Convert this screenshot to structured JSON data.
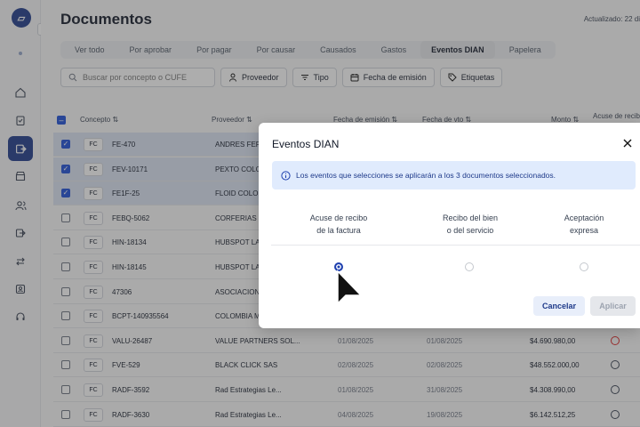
{
  "header": {
    "title": "Documentos",
    "updated": "Actualizado: 22 di"
  },
  "tabs": [
    "Ver todo",
    "Por aprobar",
    "Por pagar",
    "Por causar",
    "Causados",
    "Gastos",
    "Eventos DIAN",
    "Papelera"
  ],
  "active_tab": "Eventos DIAN",
  "search": {
    "placeholder": "Buscar por concepto o CUFE"
  },
  "filters": {
    "proveedor": "Proveedor",
    "tipo": "Tipo",
    "fecha_emision": "Fecha de emisión",
    "etiquetas": "Etiquetas"
  },
  "table": {
    "headers": {
      "concepto": "Concepto",
      "proveedor": "Proveedor",
      "fecha_emision": "Fecha de emisión",
      "fecha_vto": "Fecha de vto",
      "monto": "Monto",
      "acuse": "Acuse de recib"
    },
    "rows": [
      {
        "type": "FC",
        "concept": "FE-470",
        "provider": "ANDRES FERN",
        "emision": "",
        "vto": "",
        "monto": "",
        "selected": true
      },
      {
        "type": "FC",
        "concept": "FEV-10171",
        "provider": "PEXTO COLO",
        "emision": "",
        "vto": "",
        "monto": "",
        "selected": true
      },
      {
        "type": "FC",
        "concept": "FE1F-25",
        "provider": "FLOID COLOM",
        "emision": "",
        "vto": "",
        "monto": "",
        "selected": true
      },
      {
        "type": "FC",
        "concept": "FEBQ-5062",
        "provider": "CORFERIAS IN",
        "emision": "",
        "vto": "",
        "monto": "",
        "selected": false
      },
      {
        "type": "FC",
        "concept": "HIN-18134",
        "provider": "HUBSPOT LA",
        "emision": "",
        "vto": "",
        "monto": "",
        "selected": false
      },
      {
        "type": "FC",
        "concept": "HIN-18145",
        "provider": "HUBSPOT LA",
        "emision": "",
        "vto": "",
        "monto": "",
        "selected": false
      },
      {
        "type": "FC",
        "concept": "47306",
        "provider": "ASOCIACION",
        "emision": "",
        "vto": "",
        "monto": "",
        "selected": false
      },
      {
        "type": "FC",
        "concept": "BCPT-140935564",
        "provider": "COLOMBIA M",
        "emision": "",
        "vto": "",
        "monto": "",
        "selected": false
      },
      {
        "type": "FC",
        "concept": "VALU-26487",
        "provider": "VALUE PARTNERS SOL...",
        "emision": "01/08/2025",
        "vto": "01/08/2025",
        "monto": "$4.690.980,00",
        "selected": false
      },
      {
        "type": "FC",
        "concept": "FVE-529",
        "provider": "BLACK CLICK SAS",
        "emision": "02/08/2025",
        "vto": "02/08/2025",
        "monto": "$48.552.000,00",
        "selected": false
      },
      {
        "type": "FC",
        "concept": "RADF-3592",
        "provider": "Rad Estrategias Le...",
        "emision": "01/08/2025",
        "vto": "31/08/2025",
        "monto": "$4.308.990,00",
        "selected": false
      },
      {
        "type": "FC",
        "concept": "RADF-3630",
        "provider": "Rad Estrategias Le...",
        "emision": "04/08/2025",
        "vto": "19/08/2025",
        "monto": "$6.142.512,25",
        "selected": false
      }
    ]
  },
  "modal": {
    "title": "Eventos DIAN",
    "info": "Los eventos que selecciones se aplicarán a los 3 documentos seleccionados.",
    "options": [
      {
        "label": "Acuse de recibo\nde la factura",
        "selected": true
      },
      {
        "label": "Recibo del bien\no del servicio",
        "selected": false
      },
      {
        "label": "Aceptación\nexpresa",
        "selected": false
      }
    ],
    "cancel": "Cancelar",
    "apply": "Aplicar"
  },
  "colors": {
    "brand": "#1e3a8a",
    "selected_row": "#dbe4f3",
    "info_bg": "#e0ebfd",
    "alert": "#dc2626"
  }
}
